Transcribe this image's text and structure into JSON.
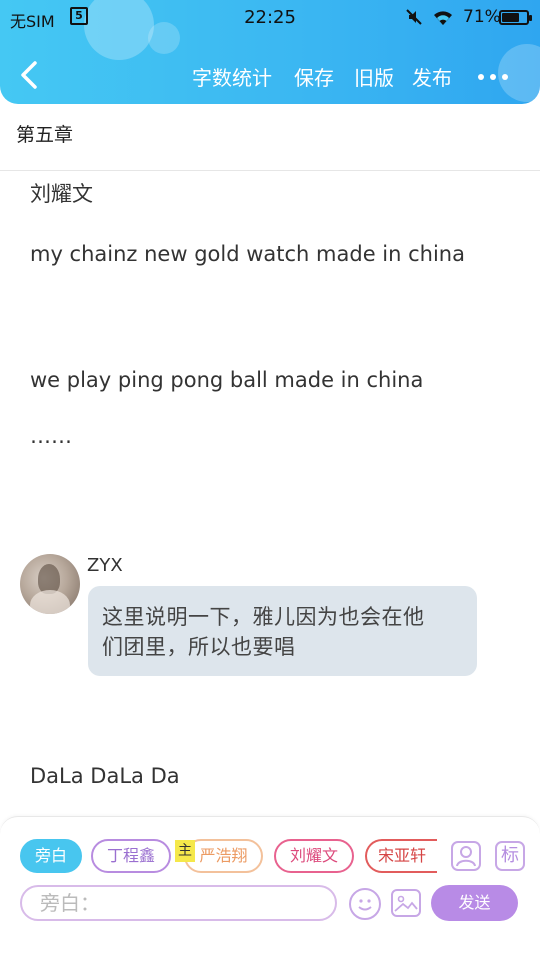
{
  "status_bar": {
    "carrier": "无SIM",
    "sim_icon_label": "5",
    "time": "22:25",
    "battery": "71%",
    "battery_level": 0.71,
    "icons": [
      "sim-icon",
      "mute-icon",
      "wifi-icon",
      "battery-icon"
    ]
  },
  "appbar": {
    "back_icon": "chevron-left-icon",
    "menu": [
      "字数统计",
      "保存",
      "旧版",
      "发布"
    ],
    "more_icon": "more-dots-icon",
    "gradient": [
      "#45c8f3",
      "#2fa6f0"
    ]
  },
  "chapter": {
    "title": "第五章"
  },
  "content": {
    "lines": [
      "刘耀文",
      "my chainz new gold watch made in china",
      "we play ping pong ball made in china",
      "……",
      "DaLa DaLa Da"
    ],
    "chat": {
      "speaker": "ZYX",
      "message_line1": "这里说明一下，雅儿因为也会在他",
      "message_line2": "们团里，所以也要唱"
    }
  },
  "editor": {
    "roles": [
      "旁白",
      "丁程鑫",
      "严浩翔",
      "刘耀文",
      "宋亚轩"
    ],
    "main_tag": "主",
    "tag_icon_label": "标",
    "input_placeholder": "旁白：",
    "send_label": "发送",
    "accent_colors": {
      "active_chip": "#48c6ef",
      "send": "#b88be6"
    }
  }
}
